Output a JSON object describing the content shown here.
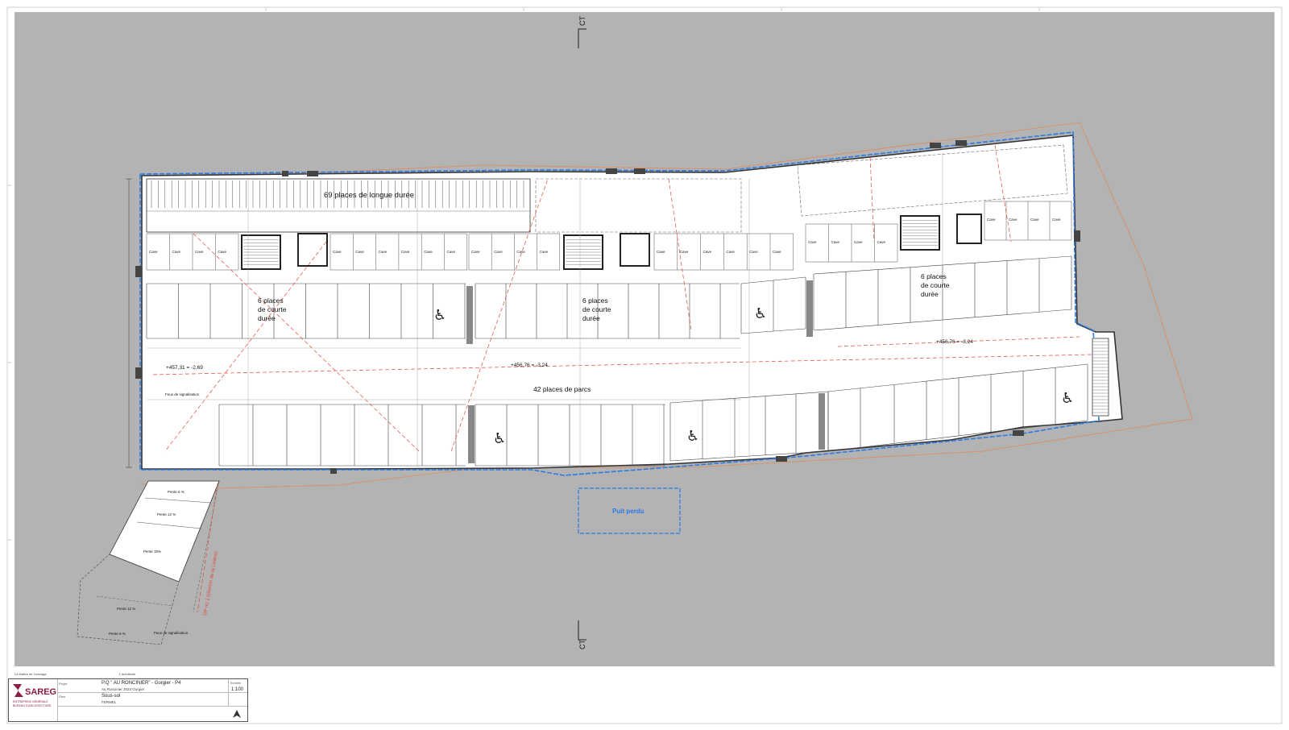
{
  "colors": {
    "sheet_bg": "#ffffff",
    "plan_bg": "#b3b3b3",
    "floor": "#ffffff",
    "wall": "#333333",
    "outline_blue": "#2a7be4",
    "section_red": "#e0483c",
    "parcel_orange": "#e08a5a",
    "logo_maroon": "#8c1d40"
  },
  "plan": {
    "labels": {
      "long_term": "69 places de longue durée",
      "short_term_1": "6 places\nde courte\ndurée",
      "short_term_2": "6 places\nde courte\ndurée",
      "short_term_3": "6 places\nde courte\ndurée",
      "parks": "42 places de parcs",
      "lvl_1": "+457,31 = -2,69",
      "lvl_2": "+456,76 = -3,24",
      "lvl_3": "+456,76 = -3,24",
      "feux_1": "Feux de signalisation",
      "feux_2": "Feux de signalisation",
      "puit": "Puit perdu",
      "section_top": "CT",
      "section_bottom": "CT",
      "ramp_1": "Pente 6 %",
      "ramp_2": "Pente 12 %",
      "ramp_3": "Pente 15%",
      "ramp_4": "Pente 12 %",
      "ramp_5": "Pente 6 %",
      "road_label": "DP no 1 (chemin de la Lisière)",
      "cave": "Cave"
    }
  },
  "titleblock": {
    "heading_left": "Le Maître de l'ouvrage",
    "heading_right": "L'architecte",
    "company": "SAREG",
    "company_sub_1": "ENTREPRISE GÉNÉRALE",
    "company_sub_2": "BUREAU D'ARCHITECTURE",
    "project_label": "Projet",
    "project": "P.Q \" AU RONCINIER\" - Gorgier - P4",
    "address": "Au Roncinier 2023 Gorgier",
    "plan_label": "Plan",
    "plan_name": "Sous-sol",
    "plan_sub": "FERMEL",
    "scale_label": "Echelle",
    "scale": "1:100"
  }
}
